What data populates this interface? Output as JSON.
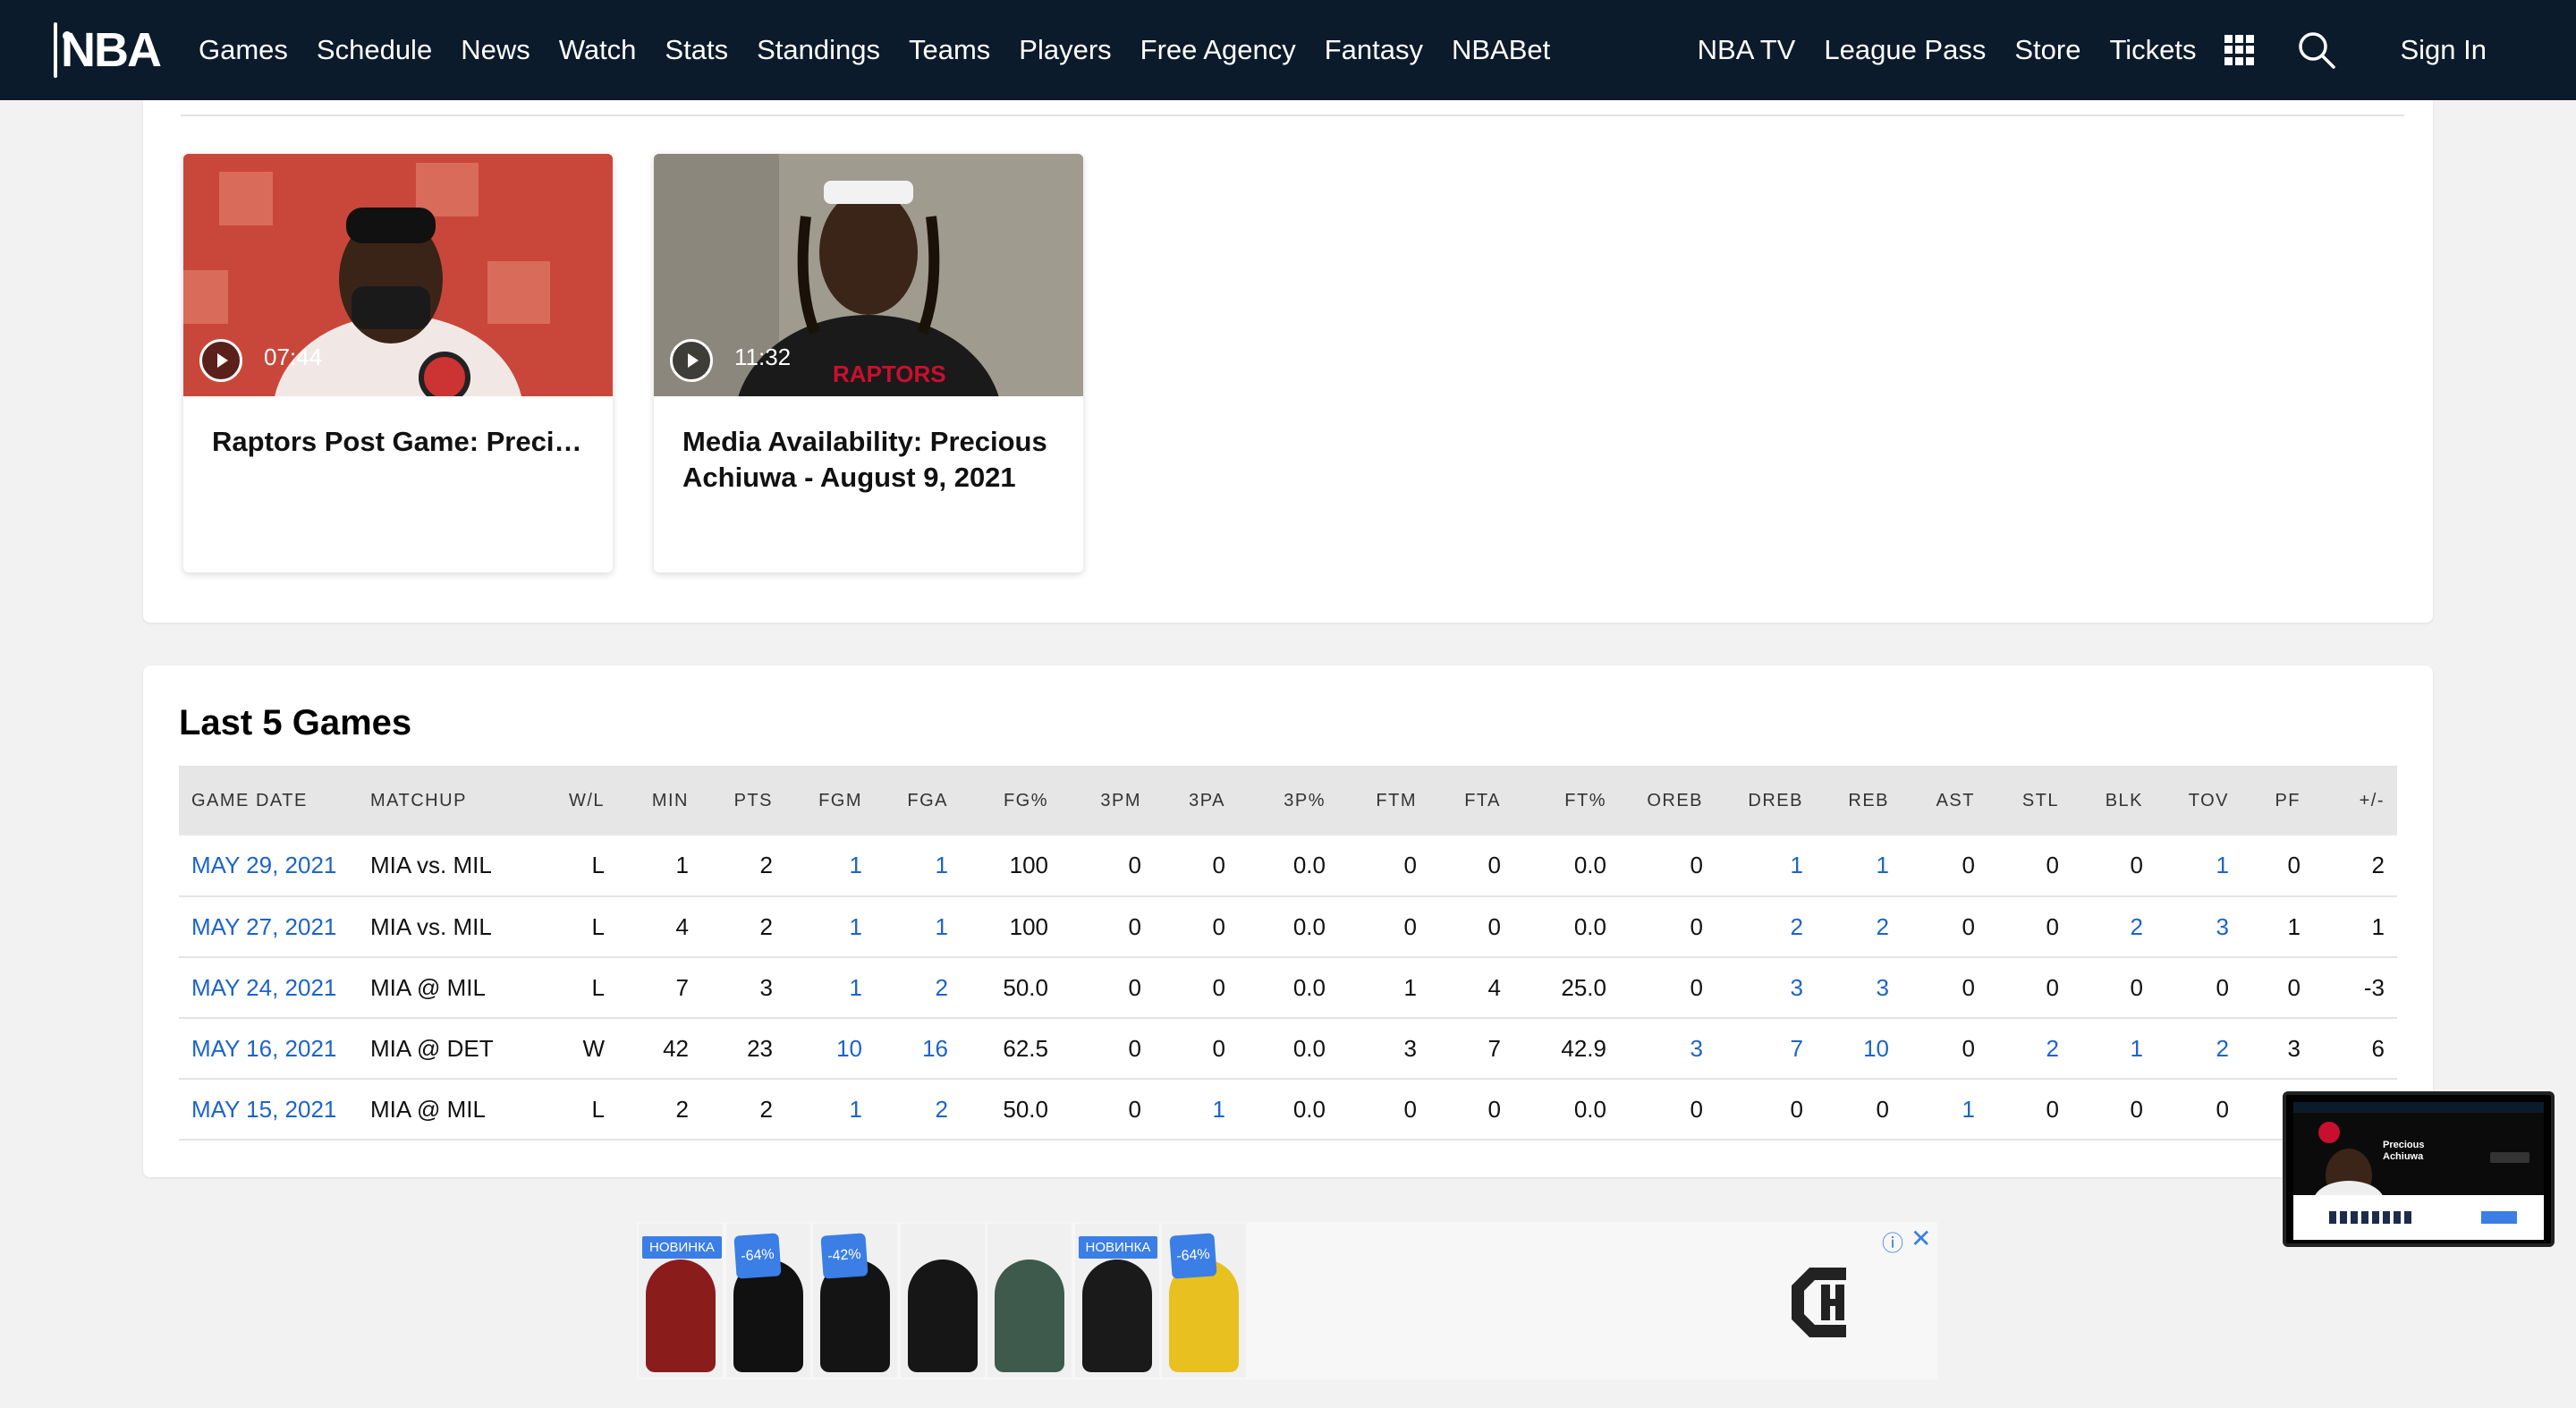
{
  "nav": {
    "logo_text": "NBA",
    "left_items": [
      "Games",
      "Schedule",
      "News",
      "Watch",
      "Stats",
      "Standings",
      "Teams",
      "Players",
      "Free Agency",
      "Fantasy",
      "NBABet"
    ],
    "right_items": [
      "NBA TV",
      "League Pass",
      "Store",
      "Tickets"
    ],
    "sign_in": "Sign In"
  },
  "videos": [
    {
      "duration": "07:44",
      "title": "Raptors Post Game: Precious Achiuwa - August…"
    },
    {
      "duration": "11:32",
      "title": "Media Availability: Precious Achiuwa - August 9, 2021"
    }
  ],
  "last_games": {
    "title": "Last 5 Games",
    "columns": [
      "GAME DATE",
      "MATCHUP",
      "W/L",
      "MIN",
      "PTS",
      "FGM",
      "FGA",
      "FG%",
      "3PM",
      "3PA",
      "3P%",
      "FTM",
      "FTA",
      "FT%",
      "OREB",
      "DREB",
      "REB",
      "AST",
      "STL",
      "BLK",
      "TOV",
      "PF",
      "+/-"
    ],
    "rows": [
      [
        "MAY 29, 2021",
        "MIA vs. MIL",
        "L",
        "1",
        "2",
        "1",
        "1",
        "100",
        "0",
        "0",
        "0.0",
        "0",
        "0",
        "0.0",
        "0",
        "1",
        "1",
        "0",
        "0",
        "0",
        "1",
        "0",
        "2"
      ],
      [
        "MAY 27, 2021",
        "MIA vs. MIL",
        "L",
        "4",
        "2",
        "1",
        "1",
        "100",
        "0",
        "0",
        "0.0",
        "0",
        "0",
        "0.0",
        "0",
        "2",
        "2",
        "0",
        "0",
        "2",
        "3",
        "1",
        "1"
      ],
      [
        "MAY 24, 2021",
        "MIA @ MIL",
        "L",
        "7",
        "3",
        "1",
        "2",
        "50.0",
        "0",
        "0",
        "0.0",
        "1",
        "4",
        "25.0",
        "0",
        "3",
        "3",
        "0",
        "0",
        "0",
        "0",
        "0",
        "-3"
      ],
      [
        "MAY 16, 2021",
        "MIA @ DET",
        "W",
        "42",
        "23",
        "10",
        "16",
        "62.5",
        "0",
        "0",
        "0.0",
        "3",
        "7",
        "42.9",
        "3",
        "7",
        "10",
        "0",
        "2",
        "1",
        "2",
        "3",
        "6"
      ],
      [
        "MAY 15, 2021",
        "MIA @ MIL",
        "L",
        "2",
        "2",
        "1",
        "2",
        "50.0",
        "0",
        "1",
        "0.0",
        "0",
        "0",
        "0.0",
        "0",
        "0",
        "0",
        "1",
        "0",
        "0",
        "0",
        "",
        ""
      ]
    ],
    "links": [
      [
        0,
        5,
        6,
        15,
        16,
        20
      ],
      [
        0,
        5,
        6,
        15,
        16,
        19,
        20
      ],
      [
        0,
        5,
        6,
        15,
        16
      ],
      [
        0,
        5,
        6,
        14,
        15,
        16,
        18,
        19,
        20
      ],
      [
        0,
        5,
        6,
        9,
        17
      ]
    ]
  },
  "ad": {
    "items": [
      {
        "badge": "НОВИНКА",
        "color": "#8a1c1c"
      },
      {
        "badge": "-64%",
        "color": "#111111"
      },
      {
        "badge": "-42%",
        "color": "#141414"
      },
      {
        "badge": "",
        "color": "#161616"
      },
      {
        "badge": "",
        "color": "#3d5a4c"
      },
      {
        "badge": "НОВИНКА",
        "color": "#1a1a1a"
      },
      {
        "badge": "-64%",
        "color": "#e8c020"
      }
    ],
    "info_icon": "ⓘ",
    "close_icon": "✕"
  },
  "mini_player": {
    "title_line1": "Precious",
    "title_line2": "Achiuwa"
  }
}
